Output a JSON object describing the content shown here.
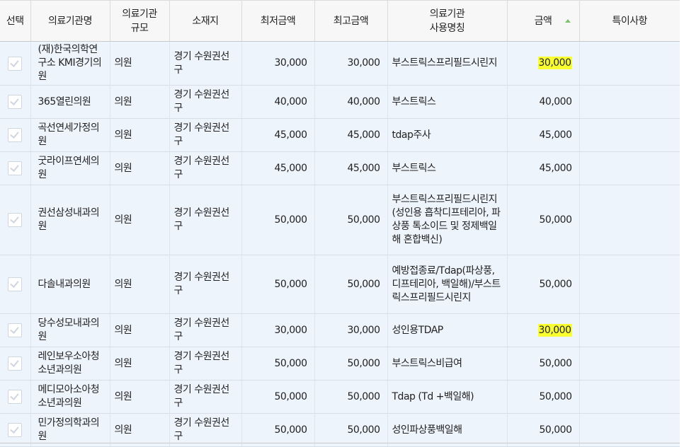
{
  "headers": {
    "select": "선택",
    "name": "의료기관명",
    "scale": "의료기관\n규모",
    "location": "소재지",
    "min_price": "최저금액",
    "max_price": "최고금액",
    "usage_name": "의료기관\n사용명칭",
    "price": "금액",
    "notes": "특이사항"
  },
  "rows": [
    {
      "name": "(재)한국의학연구소 KMI경기의원",
      "scale": "의원",
      "location": "경기 수원권선구",
      "min": "30,000",
      "max": "30,000",
      "usage": "부스트릭스프리필드시린지",
      "price": "30,000",
      "highlight": true,
      "notes": ""
    },
    {
      "name": "365열린의원",
      "scale": "의원",
      "location": "경기 수원권선구",
      "min": "40,000",
      "max": "40,000",
      "usage": "부스트릭스",
      "price": "40,000",
      "highlight": false,
      "notes": ""
    },
    {
      "name": "곡선연세가정의원",
      "scale": "의원",
      "location": "경기 수원권선구",
      "min": "45,000",
      "max": "45,000",
      "usage": "tdap주사",
      "price": "45,000",
      "highlight": false,
      "notes": ""
    },
    {
      "name": "굿라이프연세의원",
      "scale": "의원",
      "location": "경기 수원권선구",
      "min": "45,000",
      "max": "45,000",
      "usage": "부스트릭스",
      "price": "45,000",
      "highlight": false,
      "notes": ""
    },
    {
      "name": "권선삼성내과의원",
      "scale": "의원",
      "location": "경기 수원권선구",
      "min": "50,000",
      "max": "50,000",
      "usage": "부스트릭스프리필드시린지(성인용 흡착디프테리아, 파상풍 톡소이드 및 정제백일해 혼합백신)",
      "price": "50,000",
      "highlight": false,
      "notes": ""
    },
    {
      "name": "다솔내과의원",
      "scale": "의원",
      "location": "경기 수원권선구",
      "min": "50,000",
      "max": "50,000",
      "usage": "예방접종료/Tdap(파상풍, 디프테리아, 백일해)/부스트릭스프리필드시린지",
      "price": "50,000",
      "highlight": false,
      "notes": ""
    },
    {
      "name": "당수성모내과의원",
      "scale": "의원",
      "location": "경기 수원권선구",
      "min": "30,000",
      "max": "30,000",
      "usage": "성인용TDAP",
      "price": "30,000",
      "highlight": true,
      "notes": ""
    },
    {
      "name": "레인보우소아청소년과의원",
      "scale": "의원",
      "location": "경기 수원권선구",
      "min": "50,000",
      "max": "50,000",
      "usage": "부스트릭스비급여",
      "price": "50,000",
      "highlight": false,
      "notes": ""
    },
    {
      "name": "메디모아소아청소년과의원",
      "scale": "의원",
      "location": "경기 수원권선구",
      "min": "50,000",
      "max": "50,000",
      "usage": "Tdap (Td +백일해)",
      "price": "50,000",
      "highlight": false,
      "notes": ""
    },
    {
      "name": "민가정의학과의원",
      "scale": "의원",
      "location": "경기 수원권선구",
      "min": "50,000",
      "max": "50,000",
      "usage": "성인파상풍백일해",
      "price": "50,000",
      "highlight": false,
      "notes": ""
    }
  ],
  "colors": {
    "row_bg": "#eef4fc",
    "header_bg": "#f7f7f7",
    "highlight": "#f9ff2e",
    "sort_icon": "#7ac26d"
  },
  "icons": {
    "row_checkbox": "checkbox-icon",
    "sort": "sort-ascending-icon"
  }
}
